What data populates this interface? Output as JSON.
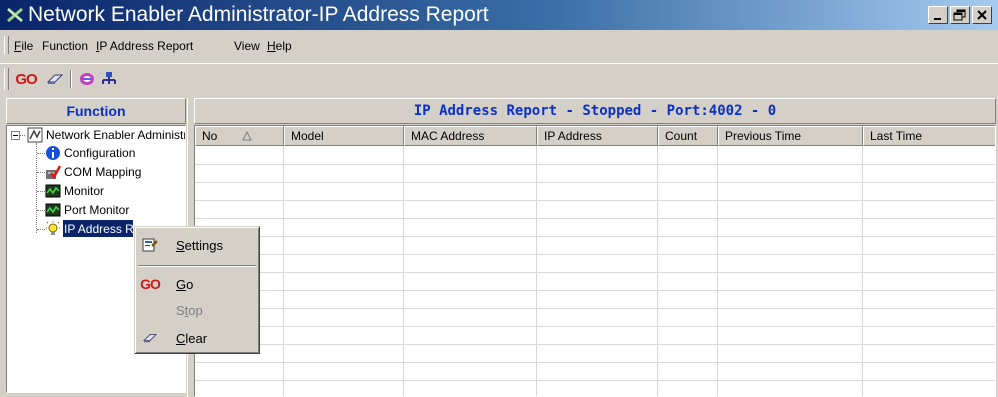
{
  "window": {
    "title": "Network Enabler Administrator-IP Address Report",
    "app_icon": "network-enabler-icon",
    "controls": [
      "minimize-icon",
      "restore-icon",
      "close-icon"
    ]
  },
  "menu": {
    "items": [
      {
        "label": "File",
        "mnemonic": "F"
      },
      {
        "label": "Function",
        "mnemonic": ""
      },
      {
        "label": "IP Address Report",
        "mnemonic": "I"
      },
      {
        "label": "View",
        "mnemonic": ""
      },
      {
        "label": "Help",
        "mnemonic": "H"
      }
    ]
  },
  "toolbar": {
    "go_label": "GO",
    "icons": [
      "go-icon",
      "clear-eraser-icon",
      "settings-icon",
      "network-icon"
    ]
  },
  "left_panel": {
    "header": "Function",
    "tree": {
      "root": "Network Enabler Administrator",
      "children": [
        {
          "label": "Configuration",
          "icon": "info-icon"
        },
        {
          "label": "COM Mapping",
          "icon": "com-mapping-icon"
        },
        {
          "label": "Monitor",
          "icon": "monitor-icon"
        },
        {
          "label": "Port Monitor",
          "icon": "port-monitor-icon"
        },
        {
          "label": "IP Address Report",
          "icon": "bulb-icon",
          "selected": true
        }
      ]
    }
  },
  "right_panel": {
    "header": "IP Address Report - Stopped - Port:4002 - 0",
    "columns": [
      "No",
      "Model",
      "MAC Address",
      "IP Address",
      "Count",
      "Previous Time",
      "Last Time"
    ],
    "sorted_column": "No",
    "rows": []
  },
  "context_menu": {
    "items": [
      {
        "label": "Settings",
        "mnemonic": "S",
        "icon": "settings-icon",
        "enabled": true
      },
      {
        "label": "Go",
        "mnemonic": "G",
        "icon": "go-icon",
        "enabled": true
      },
      {
        "label": "Stop",
        "mnemonic": "t",
        "icon": "",
        "enabled": false
      },
      {
        "label": "Clear",
        "mnemonic": "C",
        "icon": "clear-eraser-icon",
        "enabled": true
      }
    ]
  },
  "colors": {
    "header_text": "#0a30c8",
    "title_gradient_start": "#0a246a",
    "title_gradient_end": "#a6caf0",
    "go_red": "#d01818",
    "selection": "#0a246a"
  }
}
